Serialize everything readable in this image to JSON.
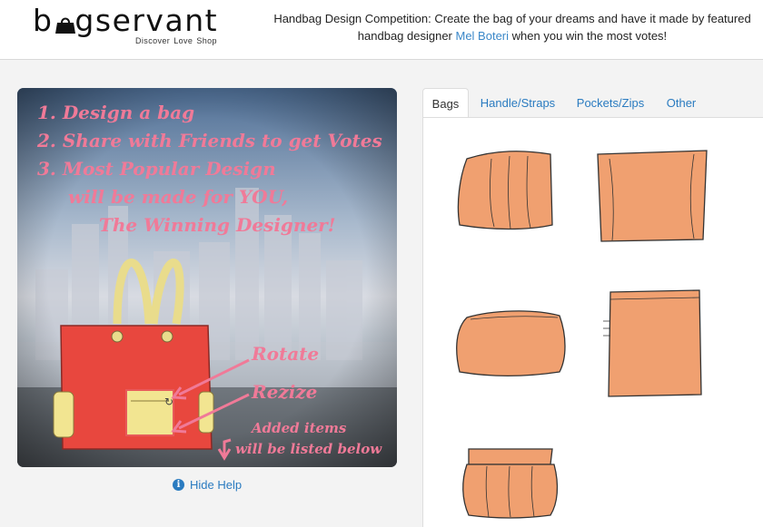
{
  "brand": {
    "logo_text": "bagservant",
    "tagline_items": [
      "Discover",
      "Love",
      "Shop"
    ]
  },
  "header": {
    "tagline_prefix": "Handbag Design Competition: Create the bag of your dreams and have it made by featured handbag designer ",
    "designer_link": "Mel Boteri",
    "tagline_suffix": " when you win the most votes!"
  },
  "help": {
    "steps": [
      "1. Design a bag",
      "2. Share with Friends to get Votes",
      "3. Most Popular Design",
      "will be made for YOU,",
      "The Winning Designer!"
    ],
    "rotate_label": "Rotate",
    "resize_label": "Rezize",
    "added_items_line1": "Added items",
    "added_items_line2": "will be listed below",
    "hide_help_label": "Hide Help"
  },
  "tabs": [
    {
      "label": "Bags",
      "active": true
    },
    {
      "label": "Handle/Straps",
      "active": false
    },
    {
      "label": "Pockets/Zips",
      "active": false
    },
    {
      "label": "Other",
      "active": false
    }
  ],
  "bag_items_count_note": "",
  "colors": {
    "link": "#2a7bc0",
    "bag_fill": "#f0a070",
    "help_text": "#f07a98",
    "help_bag": "#e8473e"
  }
}
